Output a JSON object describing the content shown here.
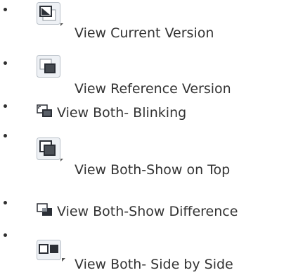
{
  "list": {
    "items": [
      {
        "label": "View Current Version",
        "icon": "view-current-version-icon"
      },
      {
        "label": "View Reference Version",
        "icon": "view-reference-version-icon"
      },
      {
        "label": "View Both- Blinking",
        "icon": "view-both-blinking-icon"
      },
      {
        "label": "View Both-Show on Top",
        "icon": "view-both-show-on-top-icon"
      },
      {
        "label": "View Both-Show Difference",
        "icon": "view-both-show-difference-icon"
      },
      {
        "label": "View Both- Side by Side",
        "icon": "view-both-side-by-side-icon"
      }
    ]
  },
  "colors": {
    "text": "#333333",
    "icon_frame": "#b9c0c8",
    "icon_dark": "#2b2f36",
    "icon_light": "#eef1f5"
  }
}
